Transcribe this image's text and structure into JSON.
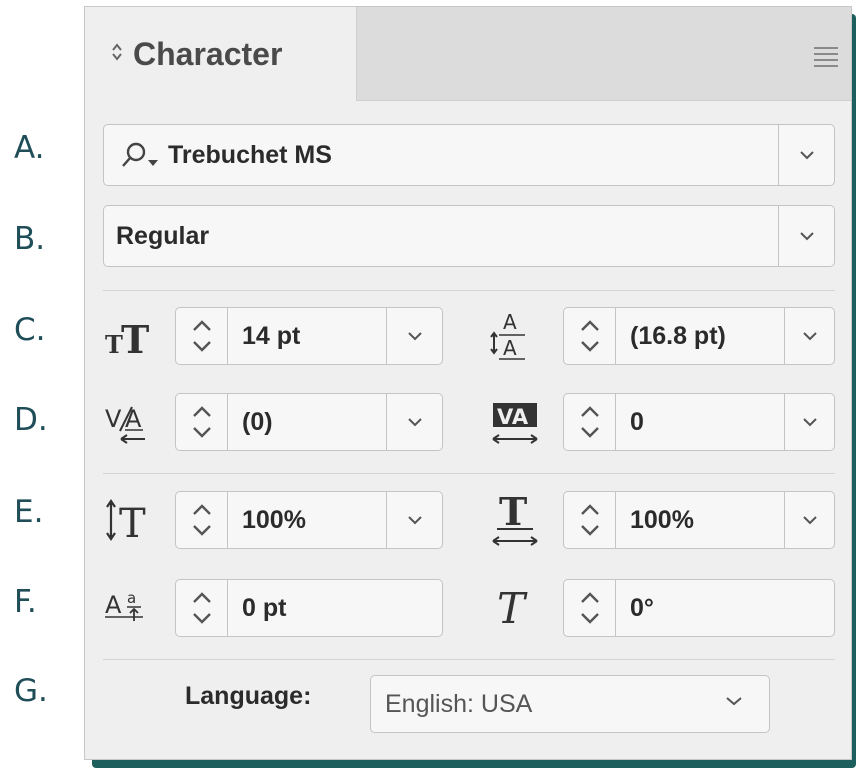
{
  "panel": {
    "title": "Character"
  },
  "annotations": [
    "A.",
    "B.",
    "C.",
    "D.",
    "E.",
    "F.",
    "G."
  ],
  "font_family": {
    "value": "Trebuchet MS"
  },
  "font_style": {
    "value": "Regular"
  },
  "font_size": {
    "value": "14 pt",
    "icon": "font-size-icon"
  },
  "leading": {
    "value": "(16.8 pt)",
    "icon": "leading-icon"
  },
  "kerning": {
    "value": "(0)",
    "icon": "kerning-icon"
  },
  "tracking": {
    "value": "0",
    "icon": "tracking-icon"
  },
  "vertical_scale": {
    "value": "100%",
    "icon": "vertical-scale-icon"
  },
  "horizontal_scale": {
    "value": "100%",
    "icon": "horizontal-scale-icon"
  },
  "baseline_shift": {
    "value": "0 pt",
    "icon": "baseline-shift-icon"
  },
  "skew": {
    "value": "0°",
    "icon": "skew-icon"
  },
  "language": {
    "label": "Language:",
    "value": "English: USA"
  },
  "colors": {
    "panel_bg": "#efefef",
    "shadow": "#1c5f5c",
    "annotation_text": "#1f4e58"
  }
}
